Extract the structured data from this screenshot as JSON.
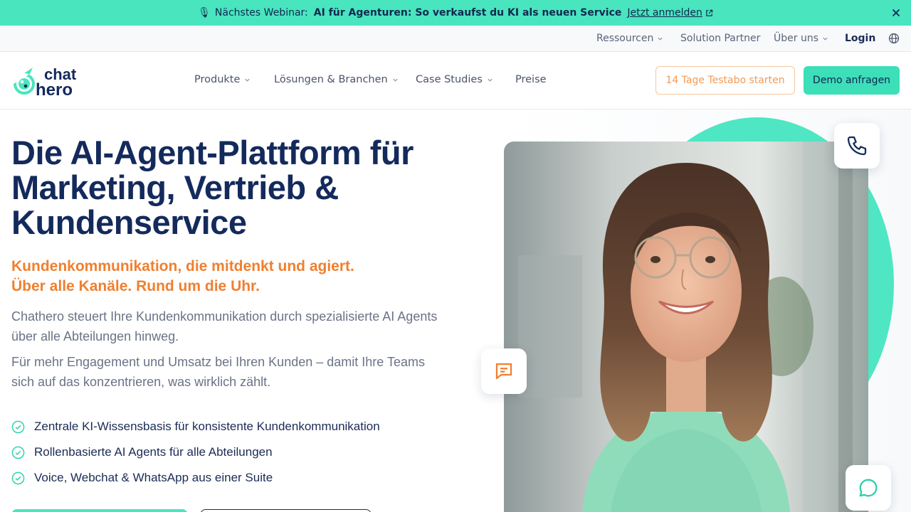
{
  "announcement": {
    "icon": "microphone-icon",
    "lead": "Nächstes Webinar:",
    "title": "AI für Agenturen: So verkaufst du KI als neuen Service",
    "cta": "Jetzt anmelden"
  },
  "utility_nav": {
    "items": [
      {
        "label": "Ressourcen",
        "has_dropdown": true
      },
      {
        "label": "Solution Partner",
        "has_dropdown": false
      },
      {
        "label": "Über uns",
        "has_dropdown": true
      },
      {
        "label": "Login",
        "has_dropdown": false
      }
    ],
    "language_icon": "globe-icon"
  },
  "brand": {
    "logo_top": "chat",
    "logo_bottom": "hero"
  },
  "main_nav": {
    "items": [
      {
        "label": "Produkte",
        "has_dropdown": true
      },
      {
        "label": "Lösungen & Branchen",
        "has_dropdown": true
      },
      {
        "label": "Case Studies",
        "has_dropdown": true
      },
      {
        "label": "Preise",
        "has_dropdown": false
      }
    ],
    "trial_button": "14 Tage Testabo starten",
    "demo_button": "Demo anfragen"
  },
  "hero": {
    "headline": "Die AI-Agent-Plattform für Marketing, Vertrieb & Kundenservice",
    "subheadline_line1": "Kundenkommunikation, die mitdenkt und agiert.",
    "subheadline_line2": "Über alle Kanäle. Rund um die Uhr.",
    "paragraph1": "Chathero steuert Ihre Kundenkommunikation durch spezialisierte AI Agents über alle Abteilungen hinweg.",
    "paragraph2": "Für mehr Engagement und Umsatz bei Ihren Kunden – damit Ihre Teams sich auf das konzentrieren, was wirklich zählt.",
    "features": [
      "Zentrale KI-Wissensbasis für konsistente Kundenkommunikation",
      "Rollenbasierte AI Agents für alle Abteilungen",
      "Voice, Webchat & WhatsApp aus einer Suite"
    ]
  },
  "visual": {
    "icons": [
      "phone-icon",
      "chat-icon",
      "chat-bubble-icon"
    ]
  },
  "colors": {
    "accent_mint": "#48e5bf",
    "navy": "#142a5c",
    "orange": "#f07f2f"
  }
}
